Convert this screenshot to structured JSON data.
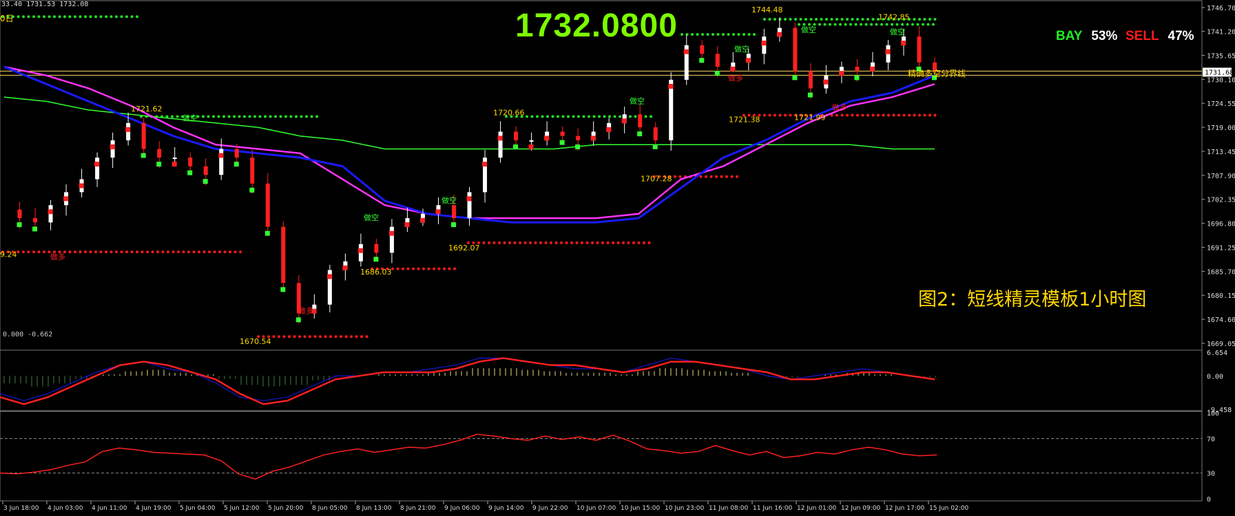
{
  "header": {
    "ohlc": "33.40 1731.53 1732.08",
    "period": "0日"
  },
  "big_price": "1732.0800",
  "sentiment": {
    "buy_label": "BAY",
    "buy_pct": "53%",
    "sell_label": "SELL",
    "sell_pct": "47%"
  },
  "caption": "图2：短线精灵模板1小时图",
  "split_line_label": "精确多空分界线",
  "current_price_tag": "1731.68",
  "osc_label": "0.000 -0.662",
  "colors": {
    "background": "#000000",
    "bull": "#ffffff",
    "bear": "#ff2020",
    "ma_blue": "#1a1aff",
    "ma_magenta": "#ff33ff",
    "ma_green": "#33ff33",
    "dot_green": "#22dd22",
    "dot_red": "#ff1a1a",
    "label_yellow": "#ffd700",
    "buy_green": "#22ee22",
    "sell_red": "#ff1a1a"
  },
  "chart_data": [
    {
      "type": "candlestick",
      "price_axis": [
        "1746.70",
        "1741.20",
        "1735.65",
        "1730.10",
        "1724.55",
        "1719.00",
        "1713.45",
        "1707.90",
        "1702.35",
        "1696.80",
        "1691.25",
        "1685.70",
        "1680.15",
        "1674.60",
        "1669.05"
      ],
      "ylim": [
        1669.05,
        1746.7
      ],
      "time_labels": [
        "3 Jun 18:00",
        "4 Jun 03:00",
        "4 Jun 11:00",
        "4 Jun 19:00",
        "5 Jun 04:00",
        "5 Jun 12:00",
        "5 Jun 20:00",
        "8 Jun 05:00",
        "8 Jun 13:00",
        "8 Jun 21:00",
        "9 Jun 06:00",
        "9 Jun 14:00",
        "9 Jun 22:00",
        "10 Jun 07:00",
        "10 Jun 15:00",
        "10 Jun 23:00",
        "11 Jun 08:00",
        "11 Jun 16:00",
        "12 Jun 01:00",
        "12 Jun 09:00",
        "12 Jun 17:00",
        "15 Jun 02:00"
      ],
      "price_annotations": [
        "1721.62",
        "1720.66",
        "1692.07",
        "1686.03",
        "1670.54",
        "1707.28",
        "1744.48",
        "1742.85",
        "1721.38",
        "1721.99",
        "9.24"
      ],
      "signal_labels": {
        "short": "做空",
        "long": "做多"
      },
      "close_path": [
        1700,
        1698,
        1697,
        1701,
        1704,
        1707,
        1712,
        1716,
        1720,
        1714,
        1712,
        1712,
        1710,
        1708,
        1714,
        1712,
        1706,
        1696,
        1683,
        1676,
        1678,
        1686,
        1688,
        1692,
        1690,
        1696,
        1698,
        1699,
        1701,
        1698,
        1704,
        1712,
        1718,
        1716,
        1716,
        1718,
        1717,
        1716,
        1718,
        1720,
        1722,
        1719,
        1716,
        1730,
        1738,
        1736,
        1733,
        1734,
        1736,
        1740,
        1742,
        1732,
        1728,
        1731,
        1733,
        1732,
        1734,
        1738,
        1740,
        1734,
        1732
      ],
      "ma_blue": [
        1733,
        1729,
        1725,
        1721,
        1717,
        1714,
        1713,
        1712,
        1710,
        1702,
        1699,
        1698,
        1697,
        1697,
        1697,
        1698,
        1705,
        1712,
        1716,
        1721,
        1725,
        1727,
        1731
      ],
      "ma_magenta": [
        1733,
        1731,
        1728,
        1724,
        1719,
        1715,
        1714,
        1713,
        1707,
        1701,
        1699,
        1698,
        1698,
        1698,
        1698,
        1699,
        1707,
        1710,
        1715,
        1720,
        1724,
        1726,
        1729
      ],
      "ma_green": [
        1726,
        1725,
        1723,
        1722,
        1721,
        1720,
        1719,
        1717,
        1716,
        1714,
        1714,
        1714,
        1714,
        1714,
        1715,
        1715,
        1715,
        1715,
        1715,
        1715,
        1715,
        1714,
        1714
      ]
    },
    {
      "type": "line",
      "name": "macd",
      "yticks": [
        "6.654",
        "0.00",
        "-9.458"
      ],
      "ylim": [
        -9.458,
        6.654
      ],
      "signal": [
        -6,
        -8,
        -6,
        -3,
        0,
        3,
        4,
        3,
        1,
        -1,
        -5,
        -8,
        -7,
        -4,
        -1,
        0,
        1,
        1,
        1,
        2,
        4,
        5,
        4,
        3,
        3,
        2,
        1,
        2,
        4,
        4,
        3,
        2,
        1,
        -1,
        -1,
        0,
        1,
        1,
        0,
        -1
      ],
      "main": [
        -5,
        -7,
        -5,
        -2,
        1,
        3,
        4,
        2,
        1,
        -2,
        -6,
        -7,
        -6,
        -3,
        0,
        0,
        1,
        1,
        2,
        3,
        5,
        5,
        4,
        3,
        2,
        2,
        1,
        3,
        5,
        4,
        3,
        2,
        0,
        -1,
        0,
        1,
        2,
        1,
        0,
        -1
      ]
    },
    {
      "type": "line",
      "name": "rsi",
      "yticks": [
        "100",
        "70",
        "30",
        "0"
      ],
      "ylim": [
        0,
        100
      ],
      "values": [
        30,
        29,
        31,
        34,
        39,
        43,
        55,
        59,
        57,
        54,
        53,
        52,
        51,
        44,
        29,
        23,
        32,
        37,
        44,
        51,
        55,
        58,
        54,
        57,
        60,
        59,
        63,
        68,
        75,
        73,
        70,
        68,
        73,
        69,
        72,
        68,
        74,
        67,
        58,
        56,
        53,
        55,
        62,
        56,
        51,
        55,
        48,
        50,
        54,
        52,
        57,
        60,
        57,
        52,
        50,
        51
      ]
    }
  ]
}
